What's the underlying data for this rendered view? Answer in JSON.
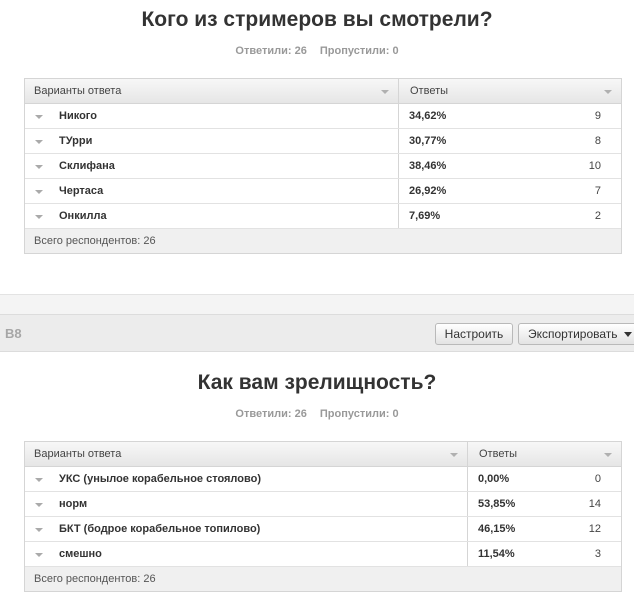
{
  "question1": {
    "title": "Кого из стримеров вы смотрели?",
    "answered_label": "Ответили: 26",
    "skipped_label": "Пропустили: 0",
    "header": {
      "options": "Варианты ответа",
      "answers": "Ответы"
    },
    "rows": [
      {
        "label": "Никого",
        "percent": "34,62%",
        "count": "9"
      },
      {
        "label": "ТУрри",
        "percent": "30,77%",
        "count": "8"
      },
      {
        "label": "Склифана",
        "percent": "38,46%",
        "count": "10"
      },
      {
        "label": "Чертаса",
        "percent": "26,92%",
        "count": "7"
      },
      {
        "label": "Онкилла",
        "percent": "7,69%",
        "count": "2"
      }
    ],
    "total": "Всего респондентов: 26"
  },
  "toolbar": {
    "page_id": "В8",
    "configure_label": "Настроить",
    "export_label": "Экспортировать"
  },
  "question2": {
    "title": "Как вам зрелищность?",
    "answered_label": "Ответили: 26",
    "skipped_label": "Пропустили: 0",
    "header": {
      "options": "Варианты ответа",
      "answers": "Ответы"
    },
    "rows": [
      {
        "label": "УКС (унылое корабельное стоялово)",
        "percent": "0,00%",
        "count": "0"
      },
      {
        "label": "норм",
        "percent": "53,85%",
        "count": "14"
      },
      {
        "label": "БКТ (бодрое корабельное топилово)",
        "percent": "46,15%",
        "count": "12"
      },
      {
        "label": "смешно",
        "percent": "11,54%",
        "count": "3"
      }
    ],
    "total": "Всего респондентов: 26"
  }
}
